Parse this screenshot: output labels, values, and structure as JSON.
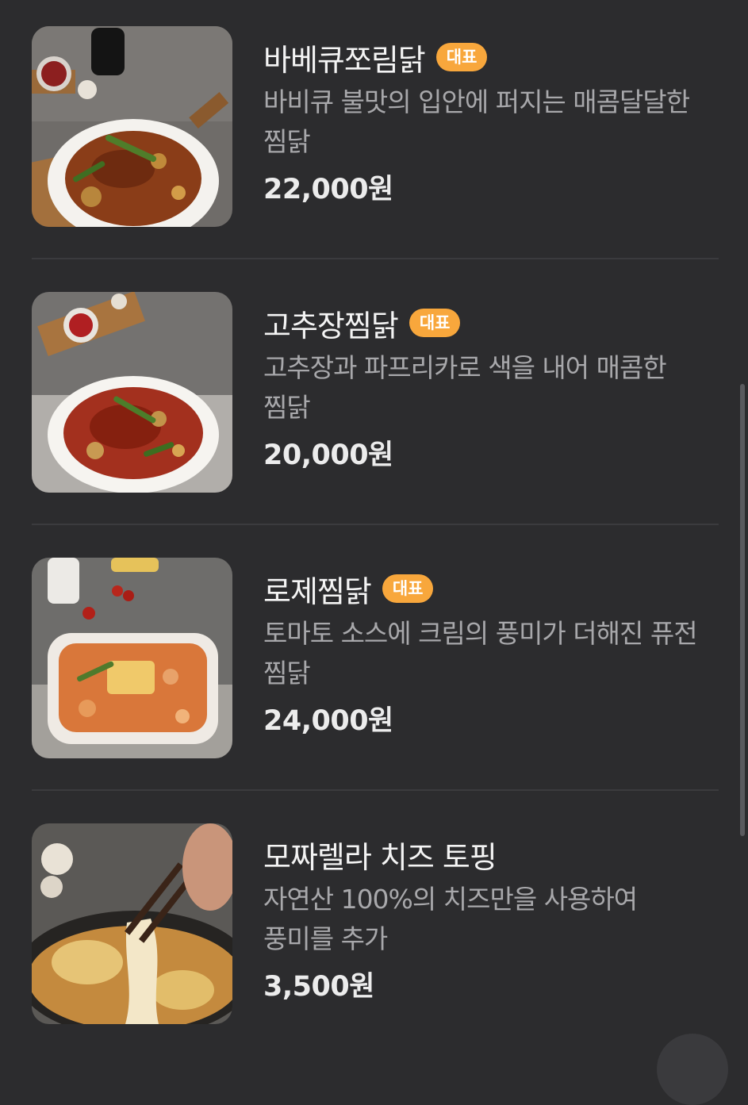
{
  "menu": {
    "items": [
      {
        "name": "바베큐쪼림닭",
        "badge": "대표",
        "description": "바비큐 불맛의 입안에 퍼지는 매콤달달한 찜닭",
        "price": "22,000원",
        "image": "bbq-jjimdak-photo"
      },
      {
        "name": "고추장찜닭",
        "badge": "대표",
        "description": "고추장과 파프리카로 색을 내어 매콤한 찜닭",
        "price": "20,000원",
        "image": "gochujang-jjimdak-photo"
      },
      {
        "name": "로제찜닭",
        "badge": "대표",
        "description": "토마토 소스에 크림의 풍미가 더해진 퓨전 찜닭",
        "price": "24,000원",
        "image": "rose-jjimdak-photo"
      },
      {
        "name": "모짜렐라 치즈 토핑",
        "badge": "",
        "description": "자연산 100%의 치즈만을 사용하여 풍미를 추가",
        "price": "3,500원",
        "image": "mozzarella-cheese-photo"
      }
    ]
  },
  "colors": {
    "background": "#2c2c2e",
    "badge": "#f8a73c",
    "description": "#a8a8ab"
  }
}
